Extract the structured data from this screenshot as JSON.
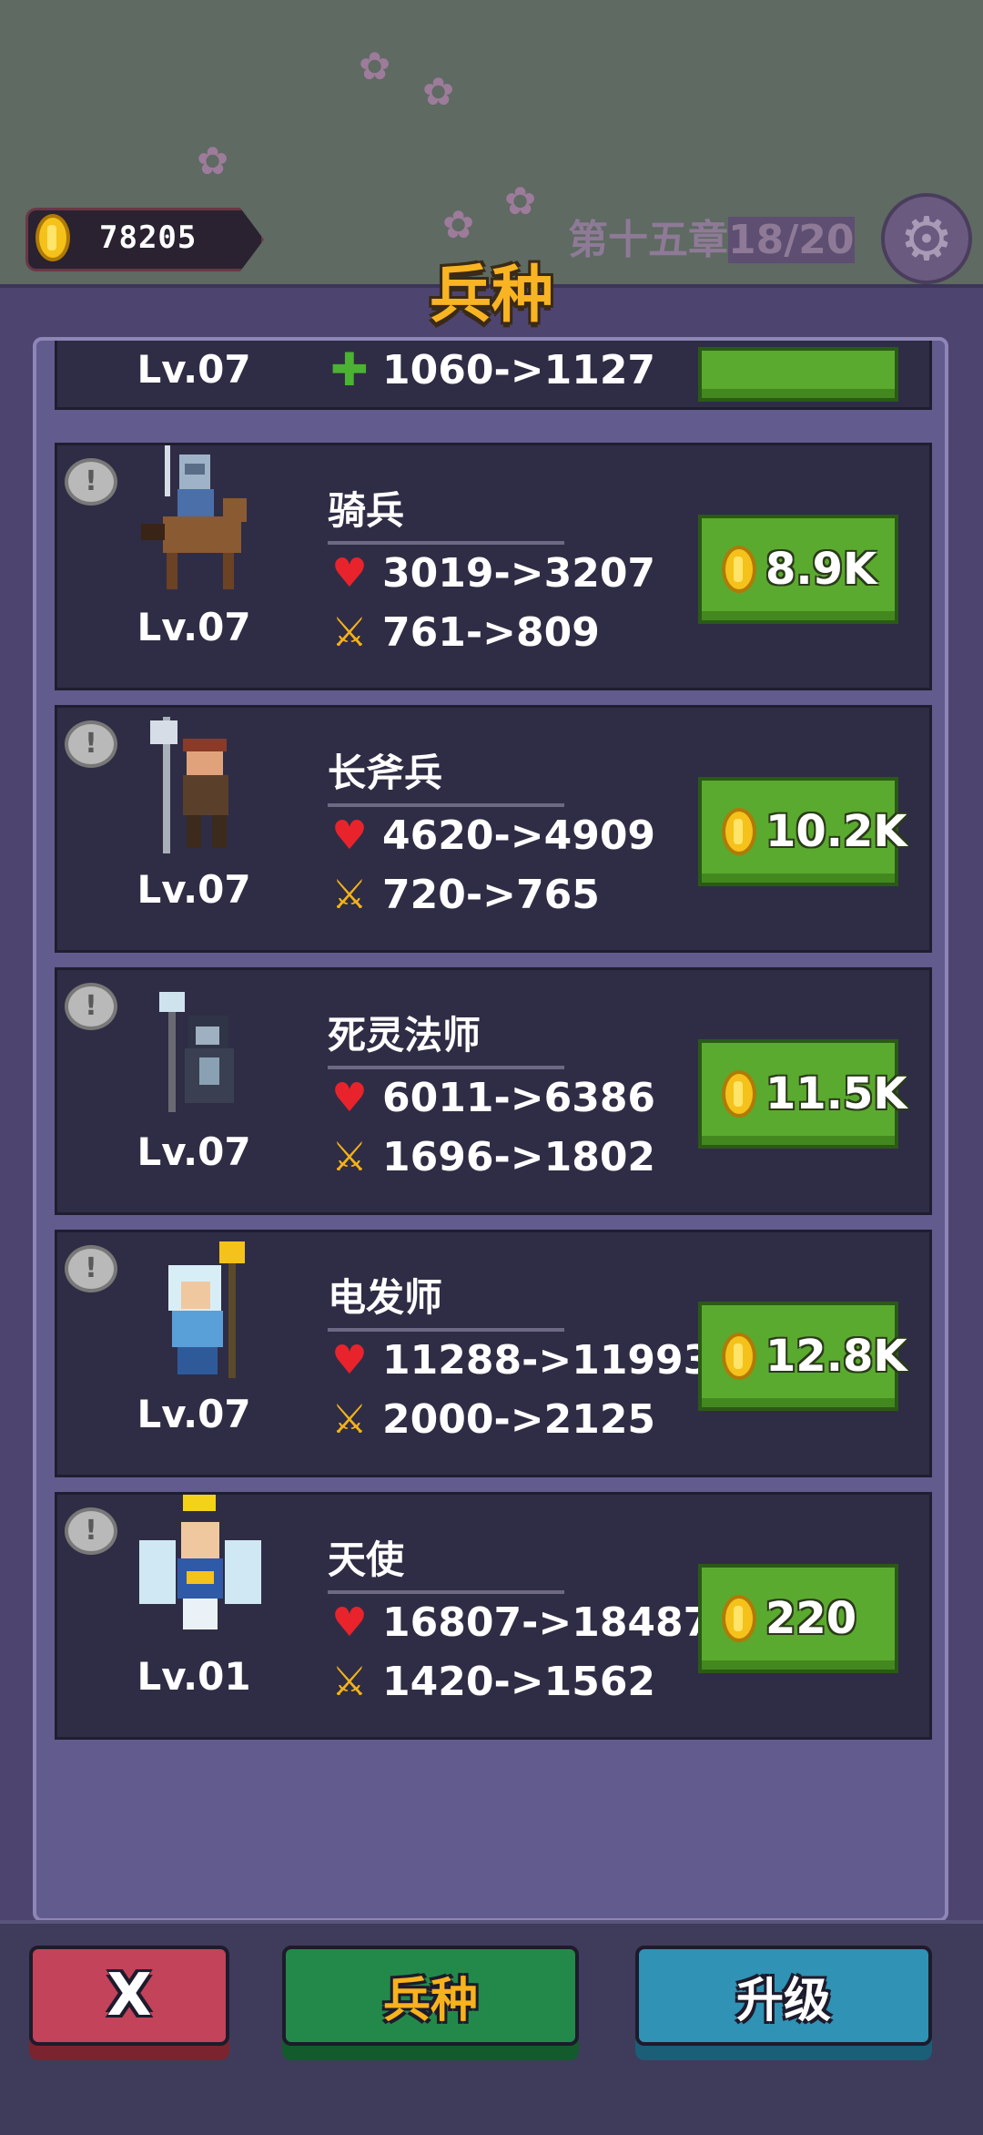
{
  "hud": {
    "coins": "78205",
    "chapter_prefix": "第十五章",
    "chapter_progress": "18/20",
    "settings_icon": "gear-icon"
  },
  "panel": {
    "title": "兵种"
  },
  "partial_card": {
    "level": "Lv.07",
    "heal": "1060->1127"
  },
  "units": [
    {
      "name": "骑兵",
      "level": "Lv.07",
      "hp": "3019->3207",
      "atk": "761->809",
      "cost": "8.9K"
    },
    {
      "name": "长斧兵",
      "level": "Lv.07",
      "hp": "4620->4909",
      "atk": "720->765",
      "cost": "10.2K"
    },
    {
      "name": "死灵法师",
      "level": "Lv.07",
      "hp": "6011->6386",
      "atk": "1696->1802",
      "cost": "11.5K"
    },
    {
      "name": "电发师",
      "level": "Lv.07",
      "hp": "11288->11993",
      "atk": "2000->2125",
      "cost": "12.8K"
    },
    {
      "name": "天使",
      "level": "Lv.01",
      "hp": "16807->18487",
      "atk": "1420->1562",
      "cost": "220"
    }
  ],
  "bottom": {
    "close_label": "X",
    "units_label": "兵种",
    "upgrade_label": "升级"
  },
  "colors": {
    "gold": "#f9b423",
    "buy_green": "#5aaa2f",
    "close_red": "#c2435a",
    "units_green": "#23894a",
    "upgrade_blue": "#3092b4",
    "heart_red": "#e8232c"
  }
}
